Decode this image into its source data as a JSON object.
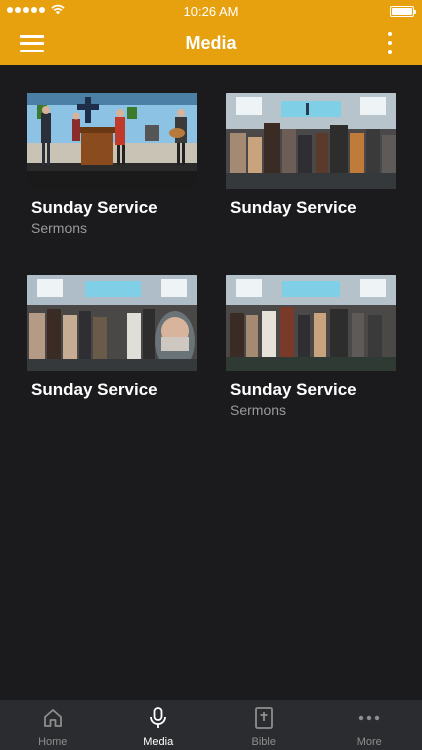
{
  "status_bar": {
    "time": "10:26 AM"
  },
  "nav": {
    "title": "Media"
  },
  "colors": {
    "accent": "#e8a10e",
    "background": "#1b1b1d",
    "tabbar": "#2b2c2f"
  },
  "media_items": [
    {
      "title": "Sunday Service",
      "subtitle": "Sermons"
    },
    {
      "title": "Sunday Service",
      "subtitle": ""
    },
    {
      "title": "Sunday Service",
      "subtitle": ""
    },
    {
      "title": "Sunday Service",
      "subtitle": "Sermons"
    }
  ],
  "tabs": [
    {
      "label": "Home",
      "icon": "home-icon",
      "active": false
    },
    {
      "label": "Media",
      "icon": "microphone-icon",
      "active": true
    },
    {
      "label": "Bible",
      "icon": "bible-icon",
      "active": false
    },
    {
      "label": "More",
      "icon": "more-icon",
      "active": false
    }
  ]
}
